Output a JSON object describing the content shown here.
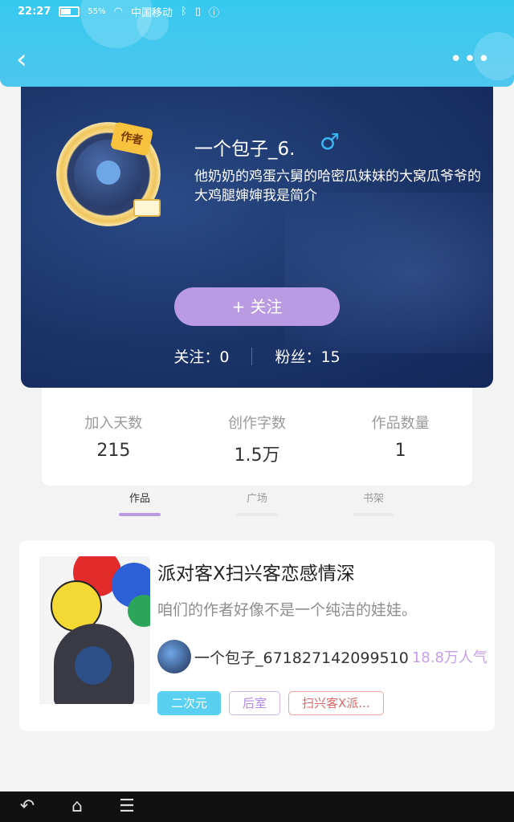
{
  "status": {
    "time": "22:27",
    "battery": "55%",
    "carrier": "中国移动"
  },
  "profile": {
    "badge": "作者",
    "username": "一个包子_6.",
    "gender_symbol": "♂",
    "bio": "他奶奶的鸡蛋六舅的哈密瓜妹妹的大窝瓜爷爷的大鸡腿婶婶我是简介",
    "follow_label": "+  关注",
    "following": "关注：0",
    "followers": "粉丝：15"
  },
  "stats": [
    {
      "label": "加入天数",
      "value": "215"
    },
    {
      "label": "创作字数",
      "value": "1.5万"
    },
    {
      "label": "作品数量",
      "value": "1"
    }
  ],
  "tabs": [
    {
      "label": "作品",
      "active": true
    },
    {
      "label": "广场",
      "active": false
    },
    {
      "label": "书架",
      "active": false
    }
  ],
  "work": {
    "title": "派对客X扫兴客恋感情深",
    "description": "咱们的作者好像不是一个纯洁的娃娃。",
    "author": "一个包子_671827142099510",
    "popularity": "18.8万人气",
    "tags": [
      "二次元",
      "后室",
      "扫兴客X派..."
    ]
  },
  "colors": {
    "header": "#37c9f0",
    "accent": "#b99ae3",
    "banner": "#1b3468"
  }
}
